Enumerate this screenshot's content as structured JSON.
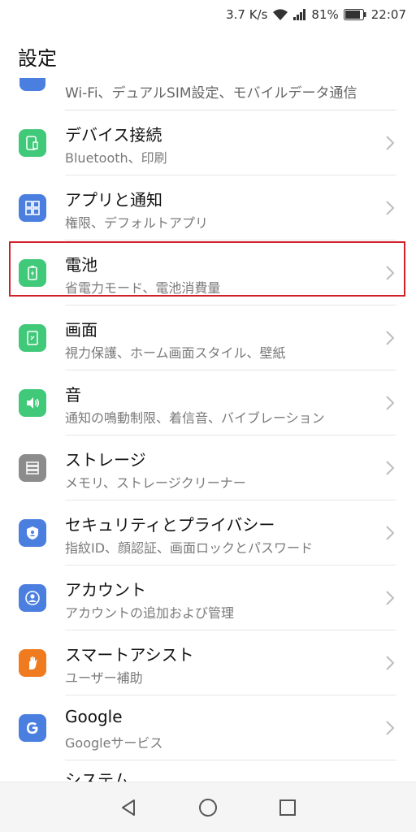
{
  "status": {
    "speed": "3.7 K/s",
    "battery_pct": "81%",
    "time": "22:07"
  },
  "header": {
    "title": "設定"
  },
  "partial_top": {
    "subtitle": "Wi-Fi、デュアルSIM設定、モバイルデータ通信"
  },
  "items": [
    {
      "title": "デバイス接続",
      "subtitle": "Bluetooth、印刷",
      "icon": "device-connect-icon",
      "color": "#3fc978"
    },
    {
      "title": "アプリと通知",
      "subtitle": "権限、デフォルトアプリ",
      "icon": "apps-icon",
      "color": "#4a7fe0"
    },
    {
      "title": "電池",
      "subtitle": "省電力モード、電池消費量",
      "icon": "battery-icon",
      "color": "#3fc978"
    },
    {
      "title": "画面",
      "subtitle": "視力保護、ホーム画面スタイル、壁紙",
      "icon": "display-icon",
      "color": "#3fc978"
    },
    {
      "title": "音",
      "subtitle": "通知の鳴動制限、着信音、バイブレーション",
      "icon": "sound-icon",
      "color": "#3fc978"
    },
    {
      "title": "ストレージ",
      "subtitle": "メモリ、ストレージクリーナー",
      "icon": "storage-icon",
      "color": "#8c8c8c"
    },
    {
      "title": "セキュリティとプライバシー",
      "subtitle": "指紋ID、顔認証、画面ロックとパスワード",
      "icon": "shield-icon",
      "color": "#4a7fe0"
    },
    {
      "title": "アカウント",
      "subtitle": "アカウントの追加および管理",
      "icon": "account-icon",
      "color": "#4a7fe0"
    },
    {
      "title": "スマートアシスト",
      "subtitle": "ユーザー補助",
      "icon": "hand-icon",
      "color": "#f07a1e"
    },
    {
      "title": "Google",
      "subtitle": "Googleサービス",
      "icon": "google-icon",
      "color": "#4a7fe0"
    }
  ],
  "partial_bottom": {
    "title": "システム"
  },
  "navbar": {
    "back": "back-icon",
    "home": "home-icon",
    "recents": "recents-icon"
  }
}
